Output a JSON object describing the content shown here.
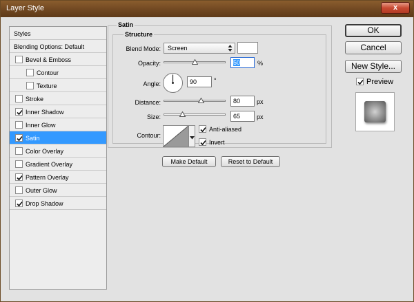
{
  "window": {
    "title": "Layer Style",
    "close_glyph": "x"
  },
  "colors": {
    "titlebar": "#7a4e24",
    "close_button": "#c94a33",
    "selection": "#3399ff",
    "dialog_bg": "#e2e2e2"
  },
  "styles_list": {
    "items": [
      {
        "label": "Styles",
        "checkbox": false,
        "indent": 0,
        "bold": false
      },
      {
        "label": "Blending Options: Default",
        "checkbox": false,
        "indent": 0,
        "bold": false
      },
      {
        "label": "Bevel & Emboss",
        "checkbox": true,
        "checked": false,
        "indent": 0
      },
      {
        "label": "Contour",
        "checkbox": true,
        "checked": false,
        "indent": 1
      },
      {
        "label": "Texture",
        "checkbox": true,
        "checked": false,
        "indent": 1
      },
      {
        "label": "Stroke",
        "checkbox": true,
        "checked": false,
        "indent": 0
      },
      {
        "label": "Inner Shadow",
        "checkbox": true,
        "checked": true,
        "indent": 0
      },
      {
        "label": "Inner Glow",
        "checkbox": true,
        "checked": false,
        "indent": 0
      },
      {
        "label": "Satin",
        "checkbox": true,
        "checked": true,
        "indent": 0,
        "selected": true
      },
      {
        "label": "Color Overlay",
        "checkbox": true,
        "checked": false,
        "indent": 0
      },
      {
        "label": "Gradient Overlay",
        "checkbox": true,
        "checked": false,
        "indent": 0
      },
      {
        "label": "Pattern Overlay",
        "checkbox": true,
        "checked": true,
        "indent": 0
      },
      {
        "label": "Outer Glow",
        "checkbox": true,
        "checked": false,
        "indent": 0
      },
      {
        "label": "Drop Shadow",
        "checkbox": true,
        "checked": true,
        "indent": 0
      }
    ]
  },
  "satin": {
    "group_title": "Satin",
    "structure_title": "Structure",
    "blend_mode": {
      "label": "Blend Mode:",
      "value": "Screen",
      "color": "#ffffff"
    },
    "opacity": {
      "label": "Opacity:",
      "value": "50",
      "unit": "%",
      "slider_fraction": 0.5
    },
    "angle": {
      "label": "Angle:",
      "value": "90",
      "unit": "°",
      "degrees": 90
    },
    "distance": {
      "label": "Distance:",
      "value": "80",
      "unit": "px",
      "slider_fraction": 0.6
    },
    "size": {
      "label": "Size:",
      "value": "65",
      "unit": "px",
      "slider_fraction": 0.3
    },
    "contour": {
      "label": "Contour:",
      "anti_aliased_label": "Anti-aliased",
      "anti_aliased": true,
      "invert_label": "Invert",
      "invert": true
    },
    "make_default_label": "Make Default",
    "reset_default_label": "Reset to Default"
  },
  "buttons": {
    "ok": "OK",
    "cancel": "Cancel",
    "new_style": "New Style..."
  },
  "preview": {
    "label": "Preview",
    "checked": true
  }
}
